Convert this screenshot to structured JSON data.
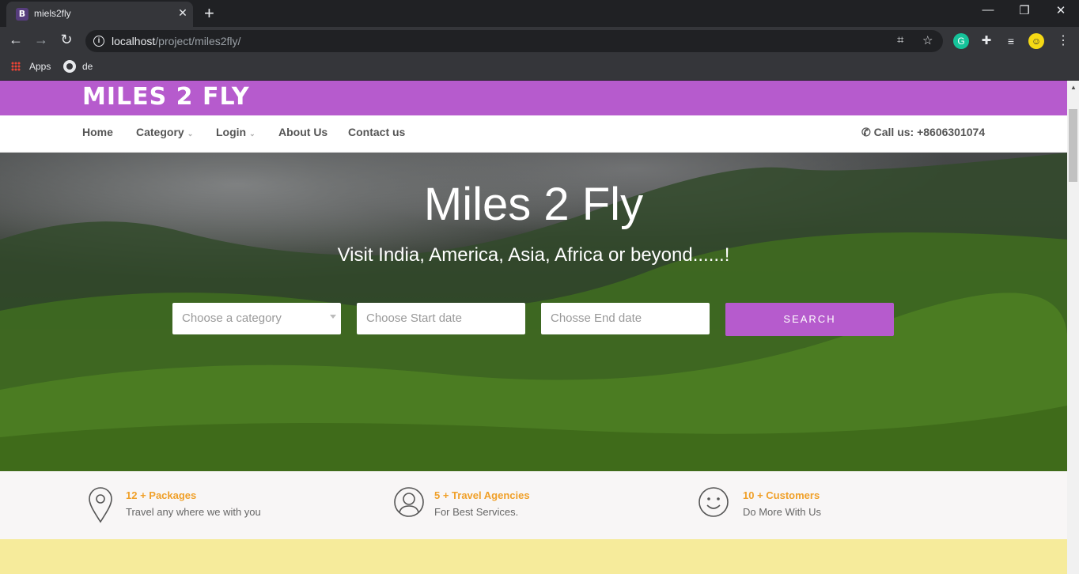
{
  "browser": {
    "tab_title": "miels2fly",
    "tab_favicon": "B",
    "url_host": "localhost",
    "url_path": "/project/miles2fly/",
    "bookmarks": [
      {
        "label": "Apps",
        "icon": "apps-grid-icon"
      },
      {
        "label": "de",
        "icon": "github-icon"
      }
    ]
  },
  "site": {
    "brand": "MILES 2 FLY",
    "brand_color": "#b65bcd",
    "nav": [
      {
        "label": "Home",
        "dropdown": false
      },
      {
        "label": "Category",
        "dropdown": true
      },
      {
        "label": "Login",
        "dropdown": true
      },
      {
        "label": "About Us",
        "dropdown": false
      },
      {
        "label": "Contact us",
        "dropdown": false
      }
    ],
    "call_us": "Call us: +8606301074"
  },
  "hero": {
    "title": "Miles 2 Fly",
    "subtitle": "Visit India, America, Asia, Africa or beyond......!",
    "category_placeholder": "Choose a category",
    "start_placeholder": "Choose Start date",
    "end_placeholder": "Chosse End date",
    "search_label": "SEARCH"
  },
  "stats": [
    {
      "icon": "map-pin-icon",
      "title": "12 + Packages",
      "text": "Travel any where we with you"
    },
    {
      "icon": "user-icon",
      "title": "5 + Travel Agencies",
      "text": "For Best Services."
    },
    {
      "icon": "smile-icon",
      "title": "10 + Customers",
      "text": "Do More With Us"
    }
  ]
}
